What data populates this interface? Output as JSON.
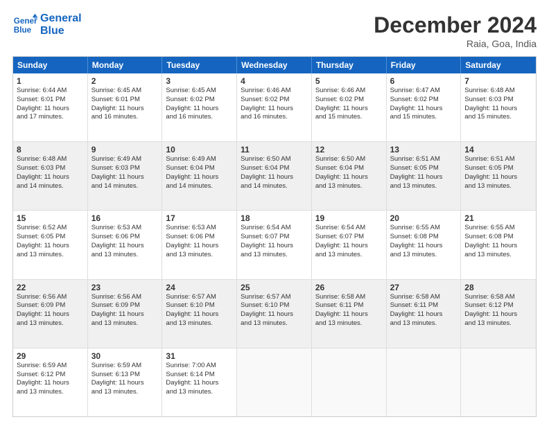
{
  "logo": {
    "line1": "General",
    "line2": "Blue"
  },
  "title": "December 2024",
  "location": "Raia, Goa, India",
  "headers": [
    "Sunday",
    "Monday",
    "Tuesday",
    "Wednesday",
    "Thursday",
    "Friday",
    "Saturday"
  ],
  "weeks": [
    [
      {
        "day": 1,
        "info": "Sunrise: 6:44 AM\nSunset: 6:01 PM\nDaylight: 11 hours\nand 17 minutes."
      },
      {
        "day": 2,
        "info": "Sunrise: 6:45 AM\nSunset: 6:01 PM\nDaylight: 11 hours\nand 16 minutes."
      },
      {
        "day": 3,
        "info": "Sunrise: 6:45 AM\nSunset: 6:02 PM\nDaylight: 11 hours\nand 16 minutes."
      },
      {
        "day": 4,
        "info": "Sunrise: 6:46 AM\nSunset: 6:02 PM\nDaylight: 11 hours\nand 16 minutes."
      },
      {
        "day": 5,
        "info": "Sunrise: 6:46 AM\nSunset: 6:02 PM\nDaylight: 11 hours\nand 15 minutes."
      },
      {
        "day": 6,
        "info": "Sunrise: 6:47 AM\nSunset: 6:02 PM\nDaylight: 11 hours\nand 15 minutes."
      },
      {
        "day": 7,
        "info": "Sunrise: 6:48 AM\nSunset: 6:03 PM\nDaylight: 11 hours\nand 15 minutes."
      }
    ],
    [
      {
        "day": 8,
        "info": "Sunrise: 6:48 AM\nSunset: 6:03 PM\nDaylight: 11 hours\nand 14 minutes."
      },
      {
        "day": 9,
        "info": "Sunrise: 6:49 AM\nSunset: 6:03 PM\nDaylight: 11 hours\nand 14 minutes."
      },
      {
        "day": 10,
        "info": "Sunrise: 6:49 AM\nSunset: 6:04 PM\nDaylight: 11 hours\nand 14 minutes."
      },
      {
        "day": 11,
        "info": "Sunrise: 6:50 AM\nSunset: 6:04 PM\nDaylight: 11 hours\nand 14 minutes."
      },
      {
        "day": 12,
        "info": "Sunrise: 6:50 AM\nSunset: 6:04 PM\nDaylight: 11 hours\nand 13 minutes."
      },
      {
        "day": 13,
        "info": "Sunrise: 6:51 AM\nSunset: 6:05 PM\nDaylight: 11 hours\nand 13 minutes."
      },
      {
        "day": 14,
        "info": "Sunrise: 6:51 AM\nSunset: 6:05 PM\nDaylight: 11 hours\nand 13 minutes."
      }
    ],
    [
      {
        "day": 15,
        "info": "Sunrise: 6:52 AM\nSunset: 6:05 PM\nDaylight: 11 hours\nand 13 minutes."
      },
      {
        "day": 16,
        "info": "Sunrise: 6:53 AM\nSunset: 6:06 PM\nDaylight: 11 hours\nand 13 minutes."
      },
      {
        "day": 17,
        "info": "Sunrise: 6:53 AM\nSunset: 6:06 PM\nDaylight: 11 hours\nand 13 minutes."
      },
      {
        "day": 18,
        "info": "Sunrise: 6:54 AM\nSunset: 6:07 PM\nDaylight: 11 hours\nand 13 minutes."
      },
      {
        "day": 19,
        "info": "Sunrise: 6:54 AM\nSunset: 6:07 PM\nDaylight: 11 hours\nand 13 minutes."
      },
      {
        "day": 20,
        "info": "Sunrise: 6:55 AM\nSunset: 6:08 PM\nDaylight: 11 hours\nand 13 minutes."
      },
      {
        "day": 21,
        "info": "Sunrise: 6:55 AM\nSunset: 6:08 PM\nDaylight: 11 hours\nand 13 minutes."
      }
    ],
    [
      {
        "day": 22,
        "info": "Sunrise: 6:56 AM\nSunset: 6:09 PM\nDaylight: 11 hours\nand 13 minutes."
      },
      {
        "day": 23,
        "info": "Sunrise: 6:56 AM\nSunset: 6:09 PM\nDaylight: 11 hours\nand 13 minutes."
      },
      {
        "day": 24,
        "info": "Sunrise: 6:57 AM\nSunset: 6:10 PM\nDaylight: 11 hours\nand 13 minutes."
      },
      {
        "day": 25,
        "info": "Sunrise: 6:57 AM\nSunset: 6:10 PM\nDaylight: 11 hours\nand 13 minutes."
      },
      {
        "day": 26,
        "info": "Sunrise: 6:58 AM\nSunset: 6:11 PM\nDaylight: 11 hours\nand 13 minutes."
      },
      {
        "day": 27,
        "info": "Sunrise: 6:58 AM\nSunset: 6:11 PM\nDaylight: 11 hours\nand 13 minutes."
      },
      {
        "day": 28,
        "info": "Sunrise: 6:58 AM\nSunset: 6:12 PM\nDaylight: 11 hours\nand 13 minutes."
      }
    ],
    [
      {
        "day": 29,
        "info": "Sunrise: 6:59 AM\nSunset: 6:12 PM\nDaylight: 11 hours\nand 13 minutes."
      },
      {
        "day": 30,
        "info": "Sunrise: 6:59 AM\nSunset: 6:13 PM\nDaylight: 11 hours\nand 13 minutes."
      },
      {
        "day": 31,
        "info": "Sunrise: 7:00 AM\nSunset: 6:14 PM\nDaylight: 11 hours\nand 13 minutes."
      },
      null,
      null,
      null,
      null
    ]
  ]
}
